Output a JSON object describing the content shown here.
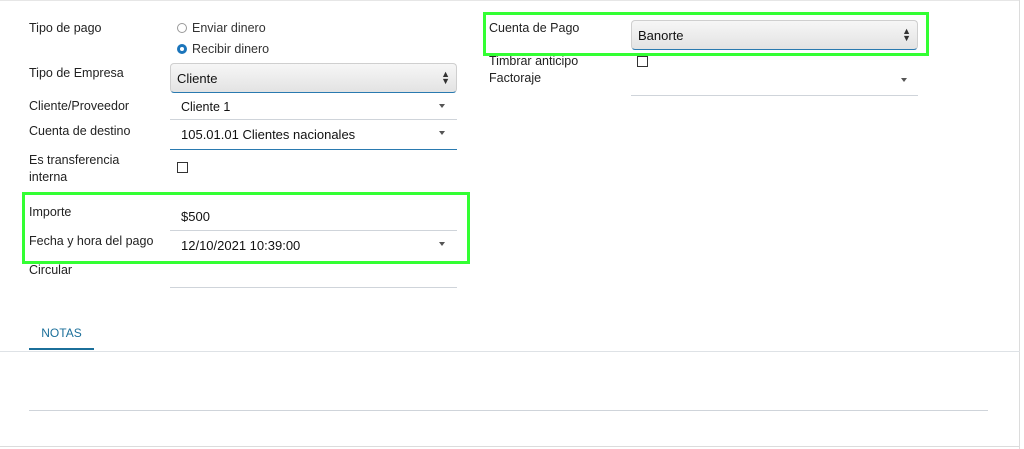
{
  "form": {
    "tipo_pago": {
      "label": "Tipo de pago",
      "options": [
        {
          "label": "Enviar dinero",
          "selected": false
        },
        {
          "label": "Recibir dinero",
          "selected": true
        }
      ]
    },
    "tipo_empresa": {
      "label": "Tipo de Empresa",
      "value": "Cliente"
    },
    "cliente_proveedor": {
      "label": "Cliente/Proveedor",
      "value": "Cliente 1"
    },
    "cuenta_destino": {
      "label": "Cuenta de destino",
      "value": "105.01.01 Clientes nacionales"
    },
    "es_transferencia": {
      "label_line1": "Es transferencia",
      "label_line2": "interna",
      "checked": false
    },
    "importe": {
      "label": "Importe",
      "value": "$500"
    },
    "fecha_hora": {
      "label": "Fecha y hora del pago",
      "value": "12/10/2021 10:39:00"
    },
    "circular": {
      "label": "Circular",
      "value": ""
    },
    "cuenta_pago": {
      "label": "Cuenta de Pago",
      "value": "Banorte"
    },
    "timbrar_anticipo": {
      "label": "Timbrar anticipo",
      "checked": false
    },
    "factoraje": {
      "label": "Factoraje",
      "value": ""
    }
  },
  "tabs": [
    {
      "label": "NOTAS",
      "active": true
    }
  ],
  "colors": {
    "highlight": "#33ff33",
    "accent": "#1b75bb",
    "focus_underline": "#2a7ab0"
  }
}
